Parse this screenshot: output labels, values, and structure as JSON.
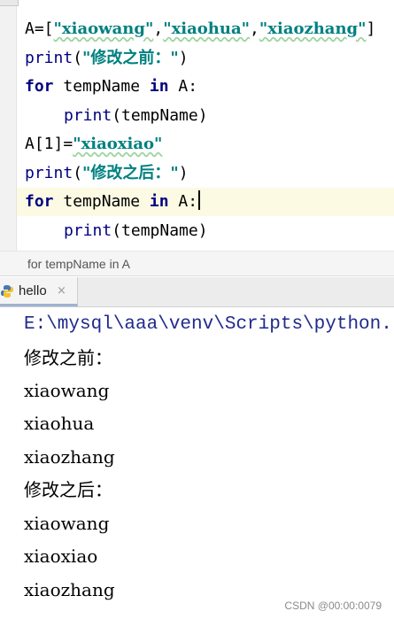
{
  "editor": {
    "line1": {
      "var": "A=[",
      "s1": "\"xiaowang\"",
      "sep1": ",",
      "s2": "\"xiaohua\"",
      "sep2": ",",
      "s3": "\"xiaozhang\"",
      "end": "]"
    },
    "line2": {
      "fn": "print",
      "open": "(",
      "str": "\"修改之前：\"",
      "close": ")"
    },
    "line3": {
      "kw1": "for",
      "mid": " tempName ",
      "kw2": "in",
      "end": " A:"
    },
    "line4": {
      "fn": "print",
      "rest": "(tempName)"
    },
    "line5": {
      "var": "A[1]=",
      "str": "\"xiaoxiao\""
    },
    "line6": {
      "fn": "print",
      "open": "(",
      "str": "\"修改之后：\"",
      "close": ")"
    },
    "line7": {
      "kw1": "for",
      "mid": " tempName ",
      "kw2": "in",
      "end": " A:"
    },
    "line8": {
      "fn": "print",
      "rest": "(tempName)"
    }
  },
  "breadcrumb": {
    "text": "for tempName in A"
  },
  "run_tab": {
    "label": "hello",
    "close": "×"
  },
  "console": {
    "lines": [
      "E:\\mysql\\aaa\\venv\\Scripts\\python.",
      "修改之前：",
      "xiaowang",
      "xiaohua",
      "xiaozhang",
      "修改之后：",
      "xiaowang",
      "xiaoxiao",
      "xiaozhang"
    ]
  },
  "watermark": "CSDN @00:00:0079",
  "colors": {
    "keyword": "#000080",
    "string": "#008080",
    "current_line": "#fcfae3",
    "console_path": "#1f2a8c"
  }
}
